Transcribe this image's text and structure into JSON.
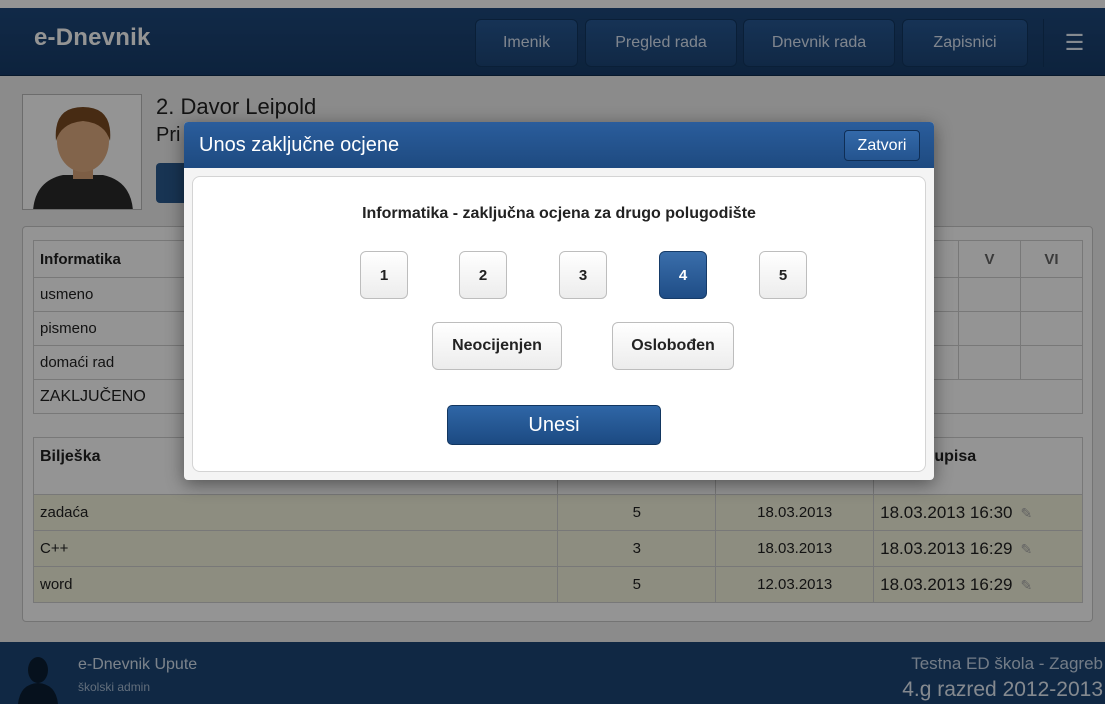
{
  "header": {
    "app_title": "e-Dnevnik",
    "nav": [
      "Imenik",
      "Pregled rada",
      "Dnevnik rada",
      "Zapisnici"
    ],
    "menu_icon": "hamburger-icon"
  },
  "student": {
    "name": "2. Davor Leipold",
    "subtitle_fragment": "Pri"
  },
  "grades_table": {
    "subject": "Informatika",
    "columns": [
      "V",
      "VI"
    ],
    "rows": [
      "usmeno",
      "pismeno",
      "domaći rad",
      "ZAKLJUČENO"
    ]
  },
  "notes_table": {
    "headers": [
      "Bilješka",
      "Datum upisa"
    ],
    "rows": [
      {
        "note": "zadaća",
        "grade": "5",
        "date": "18.03.2013",
        "entered": "18.03.2013 16:30"
      },
      {
        "note": "C++",
        "grade": "3",
        "date": "18.03.2013",
        "entered": "18.03.2013 16:29"
      },
      {
        "note": "word",
        "grade": "5",
        "date": "12.03.2013",
        "entered": "18.03.2013 16:29"
      }
    ]
  },
  "modal": {
    "title": "Unos zaključne ocjene",
    "close_label": "Zatvori",
    "subject_line": "Informatika - zaključna ocjena za drugo polugodište",
    "grades": [
      "1",
      "2",
      "3",
      "4",
      "5"
    ],
    "selected_grade": "4",
    "ungraded_label": "Neocijenjen",
    "exempt_label": "Oslobođen",
    "submit_label": "Unesi"
  },
  "footer": {
    "app_link": "e-Dnevnik Upute",
    "role": "školski admin",
    "school": "Testna ED škola - Zagreb",
    "class_year": "4.g razred 2012-2013"
  },
  "colors": {
    "brand_blue": "#1f4a7e",
    "selected_grade": "#1f4d86",
    "row_highlight": "#f3f3dd"
  }
}
